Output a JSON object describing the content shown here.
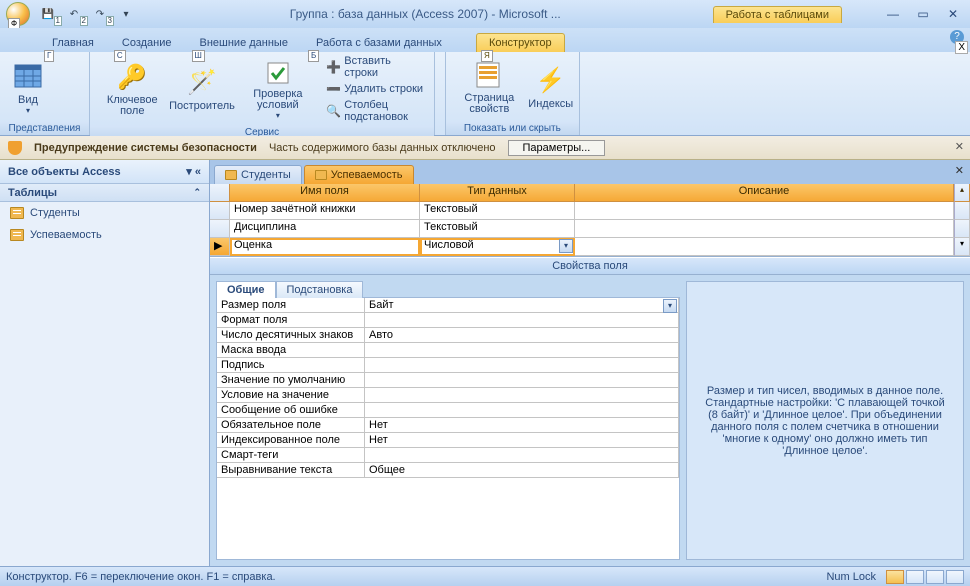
{
  "title": "Группа : база данных (Access 2007) - Microsoft ...",
  "contextTabGroup": "Работа с таблицами",
  "tabs": {
    "home": "Главная",
    "create": "Создание",
    "external": "Внешние данные",
    "dbtools": "Работа с базами данных",
    "design": "Конструктор"
  },
  "keytips": {
    "office": "Ф",
    "qat1": "1",
    "qat2": "2",
    "qat3": "3",
    "home": "Г",
    "create": "С",
    "external": "Ш",
    "dbtools": "Б",
    "design": "Я"
  },
  "ribbon": {
    "views": {
      "view": "Вид",
      "group": "Представления"
    },
    "tools": {
      "primaryKey": "Ключевое поле",
      "builder": "Построитель",
      "testRules": "Проверка условий",
      "insertRows": "Вставить строки",
      "deleteRows": "Удалить строки",
      "lookupCol": "Столбец подстановок",
      "group": "Сервис"
    },
    "showhide": {
      "propSheet": "Страница свойств",
      "indexes": "Индексы",
      "group": "Показать или скрыть"
    }
  },
  "security": {
    "title": "Предупреждение системы безопасности",
    "msg": "Часть содержимого базы данных отключено",
    "button": "Параметры..."
  },
  "nav": {
    "header": "Все объекты Access",
    "group": "Таблицы",
    "items": [
      "Студенты",
      "Успеваемость"
    ]
  },
  "docTabs": {
    "t1": "Студенты",
    "t2": "Успеваемость"
  },
  "grid": {
    "hName": "Имя поля",
    "hType": "Тип данных",
    "hDesc": "Описание",
    "rows": [
      {
        "name": "Номер зачётной книжки",
        "type": "Текстовый"
      },
      {
        "name": "Дисциплина",
        "type": "Текстовый"
      },
      {
        "name": "Оценка",
        "type": "Числовой"
      }
    ]
  },
  "propCaption": "Свойства поля",
  "propTabs": {
    "general": "Общие",
    "lookup": "Подстановка"
  },
  "props": [
    {
      "label": "Размер поля",
      "value": "Байт",
      "dd": true
    },
    {
      "label": "Формат поля",
      "value": ""
    },
    {
      "label": "Число десятичных знаков",
      "value": "Авто"
    },
    {
      "label": "Маска ввода",
      "value": ""
    },
    {
      "label": "Подпись",
      "value": ""
    },
    {
      "label": "Значение по умолчанию",
      "value": ""
    },
    {
      "label": "Условие на значение",
      "value": ""
    },
    {
      "label": "Сообщение об ошибке",
      "value": ""
    },
    {
      "label": "Обязательное поле",
      "value": "Нет"
    },
    {
      "label": "Индексированное поле",
      "value": "Нет"
    },
    {
      "label": "Смарт-теги",
      "value": ""
    },
    {
      "label": "Выравнивание текста",
      "value": "Общее"
    }
  ],
  "help": "Размер и тип чисел, вводимых в данное поле.  Стандартные настройки: 'С плавающей точкой (8 байт)' и 'Длинное целое'.  При объединении данного поля с полем счетчика в отношении 'многие к одному' оно должно иметь тип 'Длинное целое'.",
  "status": {
    "left": "Конструктор.  F6 = переключение окон.  F1 = справка.",
    "right": "Num Lock"
  }
}
